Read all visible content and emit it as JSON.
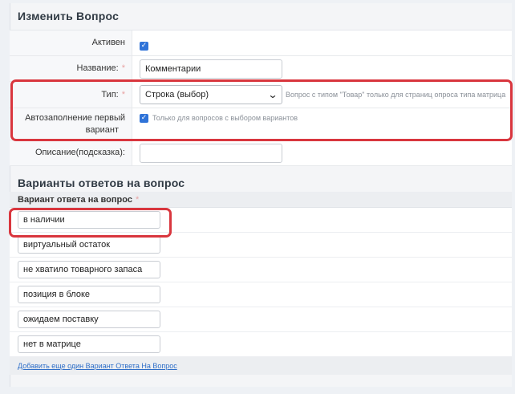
{
  "form": {
    "title": "Изменить Вопрос",
    "fields": {
      "active": {
        "label": "Активен",
        "checked": true
      },
      "name": {
        "label": "Название:",
        "required_mark": "*",
        "value": "Комментарии"
      },
      "type": {
        "label": "Тип:",
        "required_mark": "*",
        "selected": "Строка (выбор)",
        "hint": "Вопрос с типом \"Товар\" только для страниц опроса типа матрица"
      },
      "autofill": {
        "label_line1": "Автозаполнение первый",
        "label_line2": "вариант",
        "checked": true,
        "hint": "Только для вопросов с выбором вариантов"
      },
      "description": {
        "label": "Описание(подсказка):",
        "value": ""
      }
    }
  },
  "answers": {
    "title": "Варианты ответов на вопрос",
    "column_header": "Вариант ответа на вопрос",
    "required_mark": "*",
    "items": [
      "в наличии",
      "виртуальный остаток",
      "не хватило товарного запаса",
      "позиция в блоке",
      "ожидаем поставку",
      "нет в матрице"
    ],
    "add_link": "Добавить еще один Вариант Ответа На Вопрос"
  },
  "colors": {
    "highlight": "#d9363e",
    "checkbox": "#2f73d8",
    "link": "#2f6fc8"
  }
}
